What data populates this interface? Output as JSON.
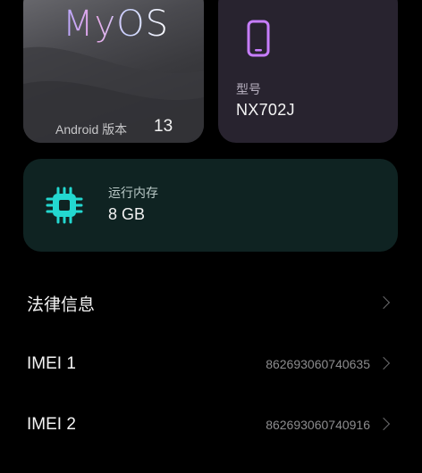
{
  "os_card": {
    "brand": "MyOS",
    "version_label": "Android 版本",
    "version_value": "13"
  },
  "model_card": {
    "icon": "phone-icon",
    "label": "型号",
    "value": "NX702J"
  },
  "ram_card": {
    "icon": "chip-icon",
    "label": "运行内存",
    "value": "8 GB"
  },
  "list": {
    "legal": {
      "label": "法律信息"
    },
    "imei1": {
      "label": "IMEI 1",
      "value": "862693060740635"
    },
    "imei2": {
      "label": "IMEI 2",
      "value": "862693060740916"
    }
  },
  "colors": {
    "background": "#000000",
    "model_card": "#28232f",
    "ram_card": "#0f2322",
    "phone_icon": "#c77dff",
    "chip_icon": "#23d8d0"
  }
}
